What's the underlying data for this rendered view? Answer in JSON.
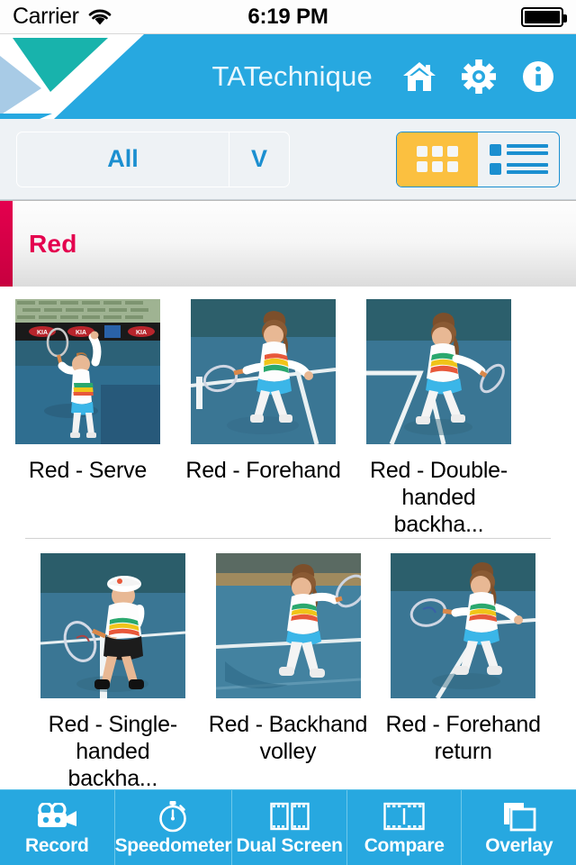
{
  "status_bar": {
    "carrier": "Carrier",
    "wifi_icon": "wifi-icon",
    "time": "6:19 PM",
    "battery_icon": "battery-full-icon"
  },
  "nav_bar": {
    "logo_icon": "app-logo-icon",
    "title": "TATechnique",
    "icons": [
      {
        "name": "home-icon",
        "label": "Home"
      },
      {
        "name": "gear-icon",
        "label": "Settings"
      },
      {
        "name": "info-icon",
        "label": "Info"
      }
    ],
    "background_color": "#27a8e0"
  },
  "filter_bar": {
    "select_value": "All",
    "select_caret": "V",
    "view_toggle": {
      "grid": {
        "name": "grid-view-icon",
        "selected": true
      },
      "list": {
        "name": "list-view-icon",
        "selected": false
      },
      "active_color": "#fbc040",
      "accent_color": "#1b8fd0"
    }
  },
  "section": {
    "title": "Red",
    "accent_color": "#e4004e"
  },
  "grid": {
    "rows": [
      {
        "cells": [
          {
            "caption": "Red - Serve",
            "thumb": "thumb-red-serve"
          },
          {
            "caption": "Red - Forehand",
            "thumb": "thumb-red-forehand"
          },
          {
            "caption": "Red - Double-handed backha...",
            "thumb": "thumb-red-double-handed-backhand"
          }
        ]
      },
      {
        "cells": [
          {
            "caption": "Red - Single-handed backha...",
            "thumb": "thumb-red-single-handed-backhand"
          },
          {
            "caption": "Red - Backhand volley",
            "thumb": "thumb-red-backhand-volley"
          },
          {
            "caption": "Red - Forehand return",
            "thumb": "thumb-red-forehand-return"
          }
        ]
      }
    ]
  },
  "toolbar": {
    "background_color": "#27a8e0",
    "items": [
      {
        "label": "Record",
        "icon": "video-camera-icon"
      },
      {
        "label": "Speedometer",
        "icon": "stopwatch-icon"
      },
      {
        "label": "Dual Screen",
        "icon": "film-frame-icon"
      },
      {
        "label": "Compare",
        "icon": "film-strip-split-icon"
      },
      {
        "label": "Overlay",
        "icon": "overlapping-squares-icon"
      }
    ]
  }
}
